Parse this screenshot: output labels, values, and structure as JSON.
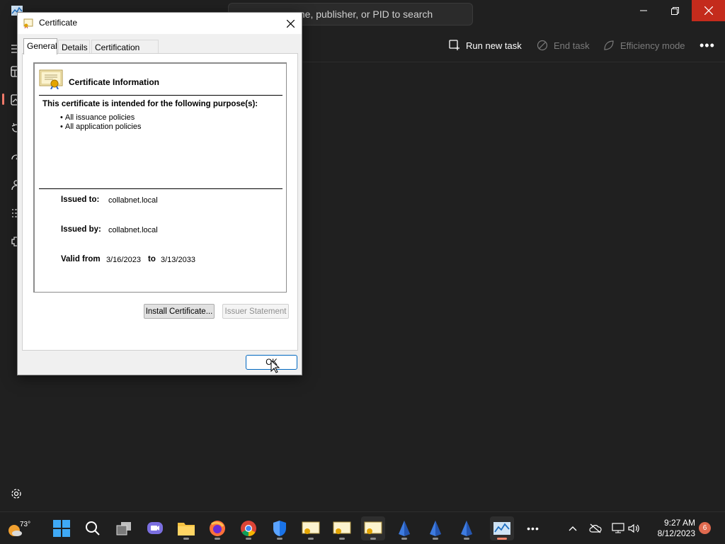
{
  "task_manager": {
    "search_placeholder": "me, publisher, or PID to search",
    "toolbar": {
      "run_new_task": "Run new task",
      "end_task": "End task",
      "efficiency_mode": "Efficiency mode"
    }
  },
  "dialog": {
    "title": "Certificate",
    "tabs": [
      "General",
      "Details",
      "Certification Path"
    ],
    "active_tab": "General",
    "heading": "Certificate Information",
    "purpose_title": "This certificate is intended for the following purpose(s):",
    "purposes": [
      "All issuance policies",
      "All application policies"
    ],
    "issued_to_label": "Issued to:",
    "issued_to_value": "collabnet.local",
    "issued_by_label": "Issued by:",
    "issued_by_value": "collabnet.local",
    "valid_from_label": "Valid from",
    "valid_from_value": "3/16/2023",
    "valid_to_label": "to",
    "valid_to_value": "3/13/2033",
    "install_button": "Install Certificate...",
    "issuer_button": "Issuer Statement",
    "ok_button": "OK"
  },
  "taskbar": {
    "weather_temp": "73°",
    "time": "9:27 AM",
    "date": "8/12/2023",
    "notification_count": "6"
  },
  "colors": {
    "close_red": "#c42b1c",
    "accent_blue": "#0067c0",
    "active_indicator": "#f0856c"
  }
}
